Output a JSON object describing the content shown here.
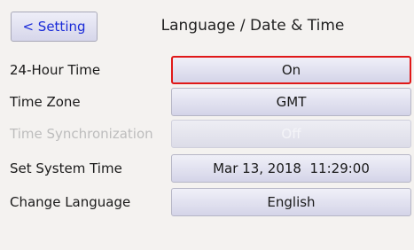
{
  "header": {
    "back_label": "< Setting",
    "title": "Language / Date & Time"
  },
  "rows": [
    {
      "label": "24-Hour Time",
      "value": "On",
      "selected": true,
      "enabled": true
    },
    {
      "label": "Time Zone",
      "value": "GMT",
      "selected": false,
      "enabled": true
    },
    {
      "label": "Time Synchronization",
      "value": "Off",
      "selected": false,
      "enabled": false
    },
    {
      "label": "Set System Time",
      "value": "Mar 13, 2018  11:29:00",
      "selected": false,
      "enabled": true
    },
    {
      "label": "Change Language",
      "value": "English",
      "selected": false,
      "enabled": true
    }
  ],
  "colors": {
    "background": "#f4f2f0",
    "back_text": "#1a2bd8",
    "selection_border": "#e01818",
    "disabled_text": "#bdbdbd"
  }
}
